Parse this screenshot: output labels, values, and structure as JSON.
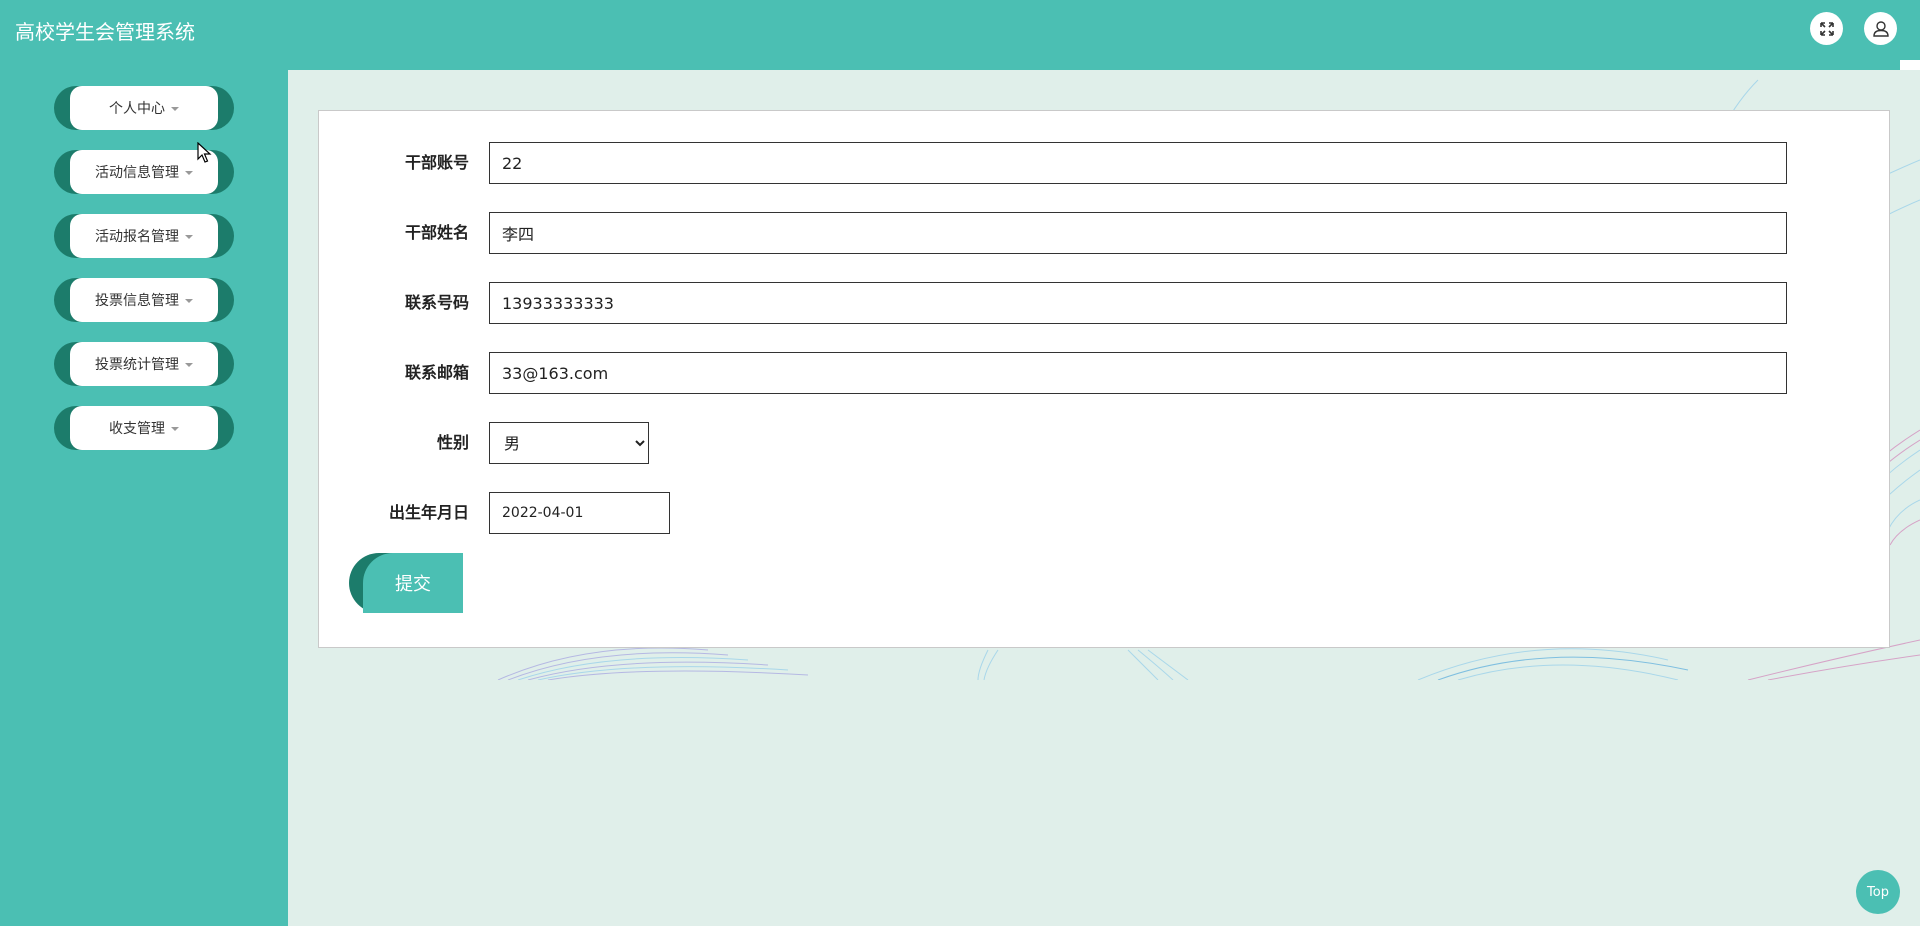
{
  "header": {
    "title": "高校学生会管理系统",
    "icons": [
      "fullscreen-icon",
      "user-icon"
    ]
  },
  "sidebar": {
    "items": [
      {
        "label": "个人中心"
      },
      {
        "label": "活动信息管理"
      },
      {
        "label": "活动报名管理"
      },
      {
        "label": "投票信息管理"
      },
      {
        "label": "投票统计管理"
      },
      {
        "label": "收支管理"
      }
    ]
  },
  "form": {
    "fields": [
      {
        "label": "干部账号",
        "value": "22"
      },
      {
        "label": "干部姓名",
        "value": "李四"
      },
      {
        "label": "联系号码",
        "value": "13933333333"
      },
      {
        "label": "联系邮箱",
        "value": "33@163.com"
      }
    ],
    "gender": {
      "label": "性别",
      "selected": "男"
    },
    "birthdate": {
      "label": "出生年月日",
      "value": "2022-04-01"
    },
    "submit_label": "提交"
  },
  "top_button": {
    "label": "Top"
  },
  "colors": {
    "primary": "#4bbfb3",
    "dark": "#1c7c6b",
    "background": "#e0efea"
  }
}
